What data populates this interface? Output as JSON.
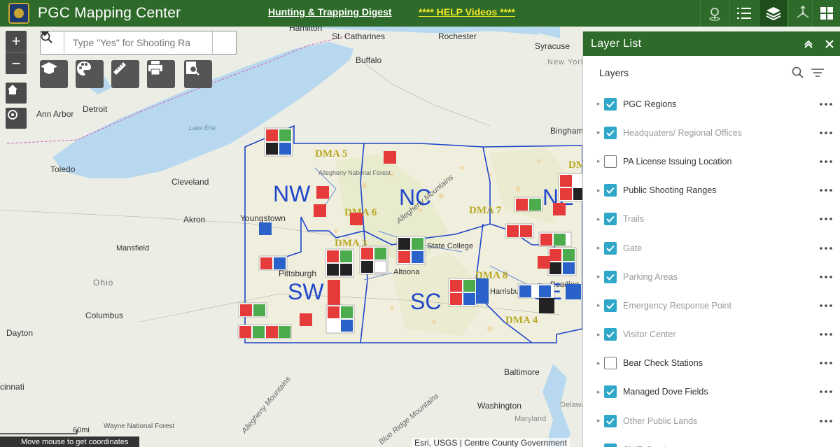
{
  "header": {
    "title": "PGC Mapping Center",
    "link_digest": "Hunting & Trapping Digest",
    "link_help": "**** HELP Videos ****",
    "icons": [
      "location-pin-icon",
      "list-icon",
      "layers-icon",
      "share-icon",
      "grid-icon"
    ],
    "accent": "#2e6b2a"
  },
  "search": {
    "placeholder": "Type \"Yes\" for Shooting Ra"
  },
  "map": {
    "cities": [
      "Hamilton",
      "St. Catharines",
      "Rochester",
      "Syracuse",
      "New York",
      "Buffalo",
      "Detroit",
      "Ann Arbor",
      "Lake Erie",
      "Toledo",
      "Cleveland",
      "Akron",
      "Youngstown",
      "Mansfield",
      "Ohio",
      "Columbus",
      "Dayton",
      "Pittsburgh",
      "Altoona",
      "State College",
      "Harrisburg",
      "Reading",
      "Binghamton",
      "Allegheny National Forest",
      "Allegheny Mountains",
      "Baltimore",
      "Washington",
      "Maryland",
      "Delaware",
      "Wayne National Forest",
      "Blue Ridge Mountains",
      "cinnati"
    ],
    "regions": [
      "NW",
      "NC",
      "NE",
      "SW",
      "SC",
      "SE"
    ],
    "dmas": [
      "DMA 5",
      "DMA 6",
      "DMA 7",
      "DMA 3",
      "DMA 8",
      "DMA 4",
      "DMA"
    ],
    "scale": "60mi",
    "coords": "Move mouse to get coordinates",
    "attribution": "Esri, USGS | Centre County Government"
  },
  "layer_panel": {
    "title": "Layer List",
    "subtitle": "Layers",
    "layers": [
      {
        "label": "PGC Regions",
        "checked": true,
        "dim": false
      },
      {
        "label": "Headquaters/ Regional Offices",
        "checked": true,
        "dim": true
      },
      {
        "label": "PA License Issuing Location",
        "checked": false,
        "dim": false
      },
      {
        "label": "Public Shooting Ranges",
        "checked": true,
        "dim": false
      },
      {
        "label": "Trails",
        "checked": true,
        "dim": true
      },
      {
        "label": "Gate",
        "checked": true,
        "dim": true
      },
      {
        "label": "Parking Areas",
        "checked": true,
        "dim": true
      },
      {
        "label": "Emergency Response Point",
        "checked": true,
        "dim": true
      },
      {
        "label": "Visitor Center",
        "checked": true,
        "dim": true
      },
      {
        "label": "Bear Check Stations",
        "checked": false,
        "dim": false
      },
      {
        "label": "Managed Dove Fields",
        "checked": true,
        "dim": false
      },
      {
        "label": "Other Public Lands",
        "checked": true,
        "dim": true
      },
      {
        "label": "CWD Services",
        "checked": true,
        "dim": true
      }
    ]
  }
}
